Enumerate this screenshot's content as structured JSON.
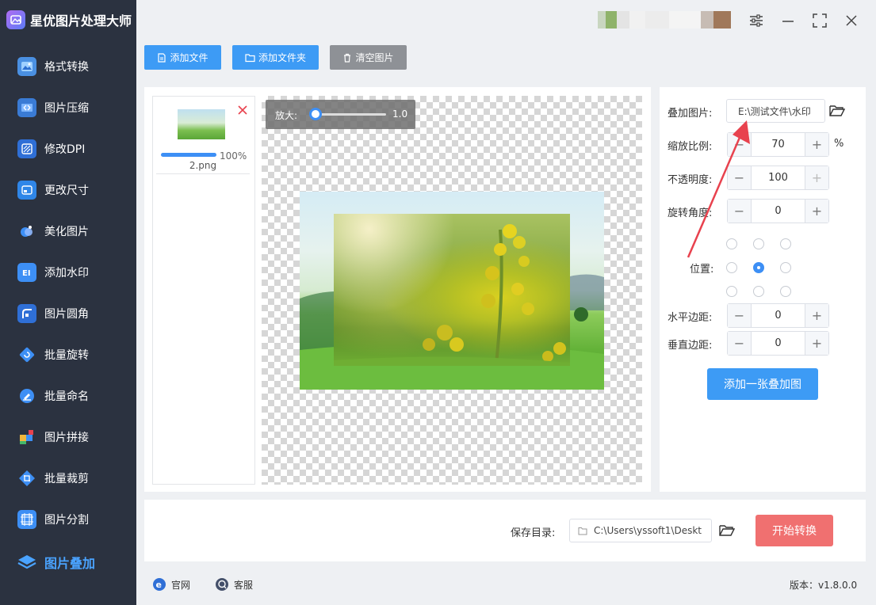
{
  "app": {
    "title": "星优图片处理大师"
  },
  "sidebar": {
    "items": [
      {
        "label": "格式转换",
        "icon": "image-convert-icon"
      },
      {
        "label": "图片压缩",
        "icon": "compress-icon"
      },
      {
        "label": "修改DPI",
        "icon": "dpi-icon"
      },
      {
        "label": "更改尺寸",
        "icon": "resize-icon"
      },
      {
        "label": "美化图片",
        "icon": "beautify-icon"
      },
      {
        "label": "添加水印",
        "icon": "watermark-icon"
      },
      {
        "label": "图片圆角",
        "icon": "rounded-corner-icon"
      },
      {
        "label": "批量旋转",
        "icon": "rotate-icon"
      },
      {
        "label": "批量命名",
        "icon": "rename-icon"
      },
      {
        "label": "图片拼接",
        "icon": "stitch-icon"
      },
      {
        "label": "批量裁剪",
        "icon": "crop-icon"
      },
      {
        "label": "图片分割",
        "icon": "split-icon"
      },
      {
        "label": "图片叠加",
        "icon": "layers-icon"
      }
    ],
    "active": "图片叠加"
  },
  "toolbar": {
    "add_file": "添加文件",
    "add_folder": "添加文件夹",
    "clear_images": "清空图片"
  },
  "file_list": [
    {
      "name": "2.png",
      "progress_label": "100%",
      "progress": 1.0
    }
  ],
  "preview": {
    "zoom_label": "放大:",
    "zoom_value": "1.0"
  },
  "settings": {
    "overlay_image_label": "叠加图片:",
    "overlay_image_path": "E:\\测试文件\\水印",
    "scale_label": "缩放比例:",
    "scale_value": "70",
    "scale_unit": "%",
    "opacity_label": "不透明度:",
    "opacity_value": "100",
    "rotation_label": "旋转角度:",
    "rotation_value": "0",
    "position_label": "位置:",
    "position_selected": "middle-center",
    "h_margin_label": "水平边距:",
    "h_margin_value": "0",
    "v_margin_label": "垂直边距:",
    "v_margin_value": "0",
    "add_overlay_button": "添加一张叠加图"
  },
  "save": {
    "label": "保存目录:",
    "path": "C:\\Users\\yssoft1\\Deskt",
    "start_button": "开始转换"
  },
  "footer": {
    "website": "官网",
    "support": "客服",
    "version": "版本：v1.8.0.0"
  },
  "colors": {
    "sidebar_bg": "#2b3240",
    "accent": "#3d9bf5",
    "active_nav": "#4aa3ff",
    "start_button": "#f07070",
    "clear_button": "#8e9196",
    "arrow": "#e8424e"
  }
}
